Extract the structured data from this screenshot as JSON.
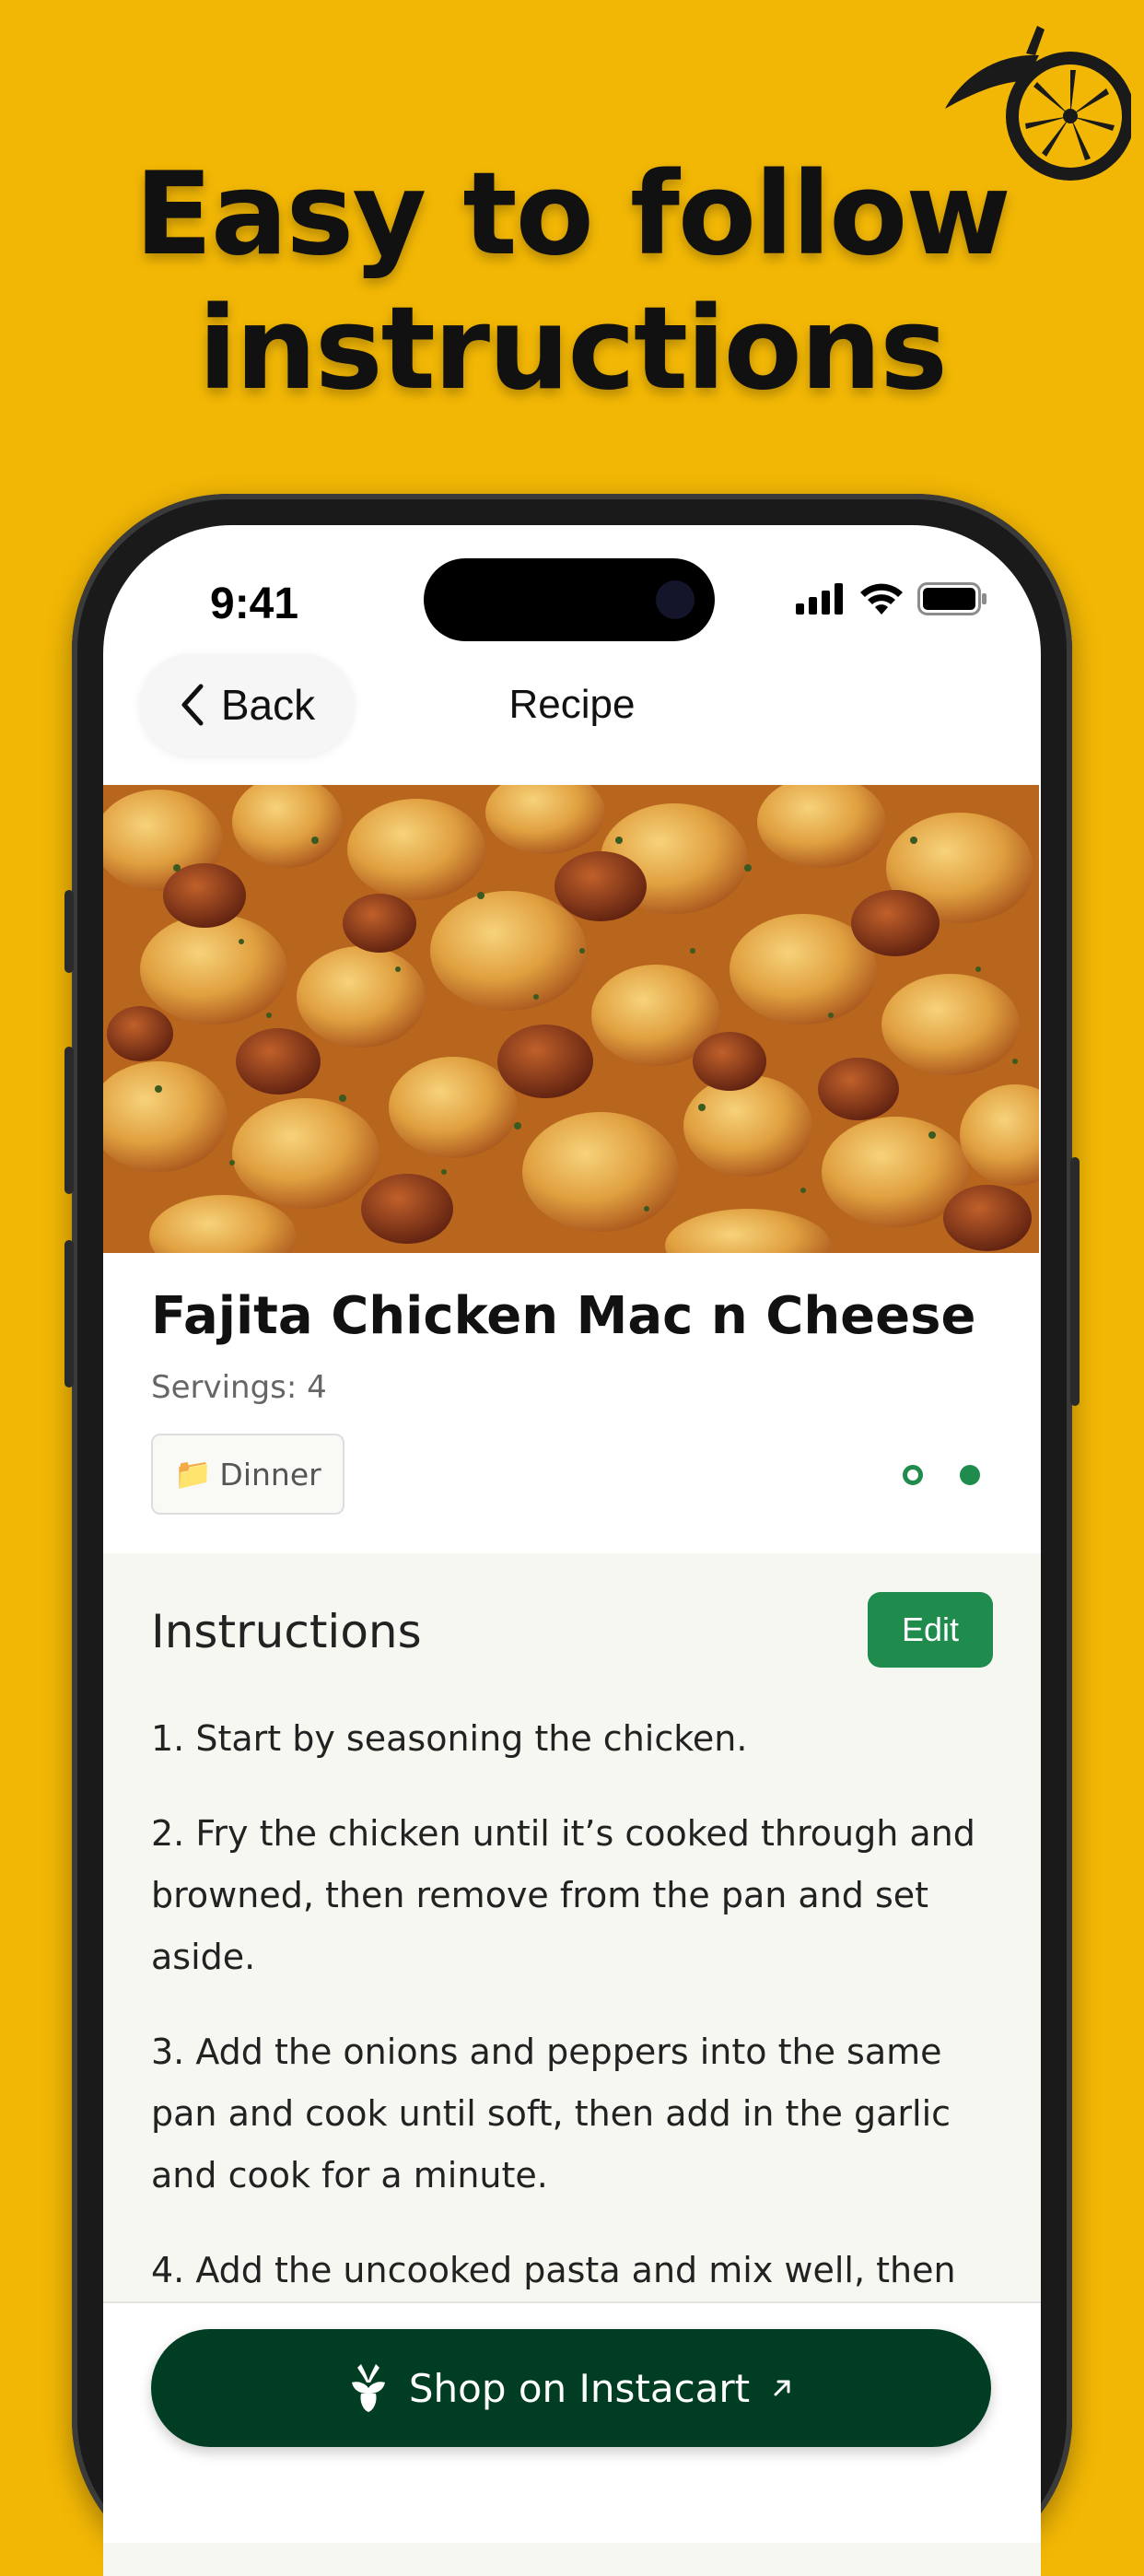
{
  "promo": {
    "headline_line1": "Easy to follow",
    "headline_line2": "instructions",
    "logo_icon": "lemon-slice-icon"
  },
  "status_bar": {
    "time": "9:41",
    "icons": [
      "signal-icon",
      "wifi-icon",
      "battery-icon"
    ]
  },
  "navbar": {
    "back_label": "Back",
    "title": "Recipe"
  },
  "recipe": {
    "title": "Fajita Chicken Mac n Cheese",
    "servings": "Servings: 4",
    "tag_icon": "folder-icon",
    "tag_emoji": "📁",
    "tag_label": "Dinner",
    "page_dots": 2,
    "active_dot": 1
  },
  "instructions": {
    "title": "Instructions",
    "edit_label": "Edit",
    "steps": [
      "1. Start by seasoning the chicken.",
      "2. Fry the chicken until it’s cooked through and browned, then remove from the pan and set aside.",
      "3. Add the onions and peppers into the same pan and cook until soft, then add in the garlic and cook for a minute.",
      "4. Add the uncooked pasta and mix well, then"
    ]
  },
  "cta": {
    "label": "Shop on Instacart",
    "icon": "instacart-carrot-icon",
    "arrow_icon": "external-arrow-icon"
  },
  "colors": {
    "background": "#F2B705",
    "accent_green": "#1f8b4c",
    "cta_dark_green": "#003d22"
  }
}
